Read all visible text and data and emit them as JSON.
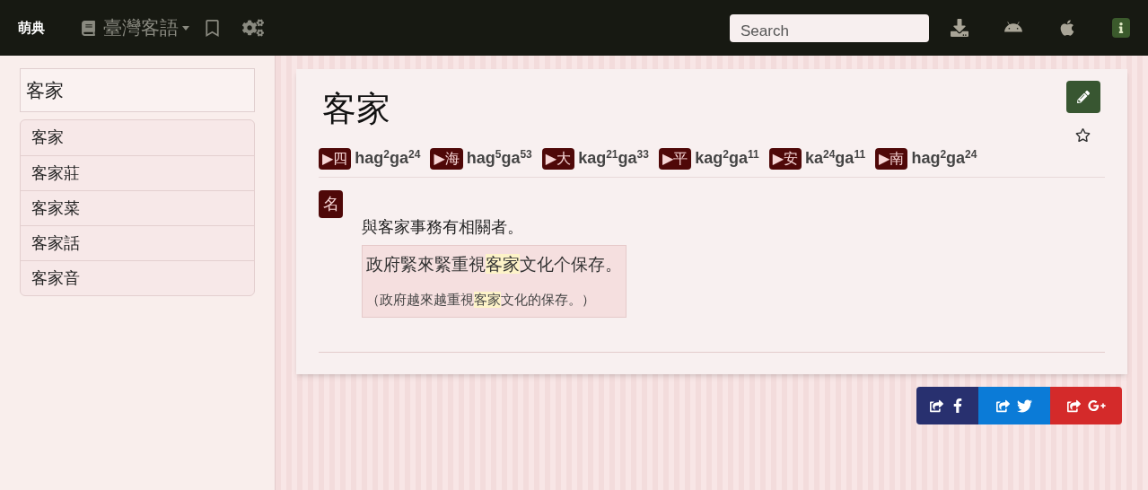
{
  "navbar": {
    "logo": "萌典",
    "dictionary": "臺灣客語",
    "search": {
      "placeholder": "Search"
    }
  },
  "sidebar": {
    "query": "客家",
    "items": [
      {
        "label": "客家"
      },
      {
        "label": "客家莊"
      },
      {
        "label": "客家菜"
      },
      {
        "label": "客家話"
      },
      {
        "label": "客家音"
      }
    ]
  },
  "entry": {
    "title": "客家",
    "pronunciations": [
      {
        "label": "▶四",
        "reading": "hag$^{2}$ga$^{24}$"
      },
      {
        "label": "▶海",
        "reading": "hag$^{5}$ga$^{53}$"
      },
      {
        "label": "▶大",
        "reading": "kag$^{21}$ga$^{33}$"
      },
      {
        "label": "▶平",
        "reading": "kag$^{2}$ga$^{11}$"
      },
      {
        "label": "▶安",
        "reading": "ka$^{24}$ga$^{11}$"
      },
      {
        "label": "▶南",
        "reading": "hag$^{2}$ga$^{24}$"
      }
    ],
    "part_of_speech": "名",
    "definition": "與客家事務有相關者。",
    "example": [
      {
        "text": "政府緊來緊重視",
        "highlight": false
      },
      {
        "text": "客家",
        "highlight": true
      },
      {
        "text": "文化个保存。",
        "highlight": false
      }
    ],
    "translation": [
      {
        "text": "（政府越來越重視",
        "highlight": false
      },
      {
        "text": "客家",
        "highlight": true
      },
      {
        "text": "文化的保存。）",
        "highlight": false
      }
    ]
  }
}
